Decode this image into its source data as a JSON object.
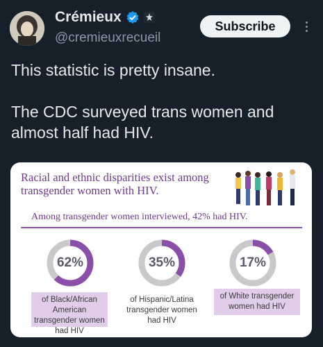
{
  "post": {
    "display_name": "Crémieux",
    "handle": "@cremieuxrecueil",
    "subscribe_label": "Subscribe",
    "text_line1": "This statistic is pretty insane.",
    "text_line2": "The CDC surveyed trans women and almost half had HIV."
  },
  "card": {
    "title": "Racial and ethnic disparities exist among transgender women with HIV.",
    "subtitle": "Among transgender women interviewed, 42% had HIV.",
    "stats": [
      {
        "percent": 62,
        "label": "62%",
        "description": "of Black/African American transgender women had HIV"
      },
      {
        "percent": 35,
        "label": "35%",
        "description": "of Hispanic/Latina transgender women had HIV"
      },
      {
        "percent": 17,
        "label": "17%",
        "description": "of White transgender women had HIV"
      }
    ]
  },
  "colors": {
    "background": "#15202b",
    "accent_purple": "#8a4fa8",
    "ring_gray": "#c9c9cc",
    "label_box": "#e1cdea",
    "verified_blue": "#1d9bf0"
  },
  "icons": [
    "verified-badge-icon",
    "affiliation-badge-icon",
    "more-options-icon"
  ]
}
